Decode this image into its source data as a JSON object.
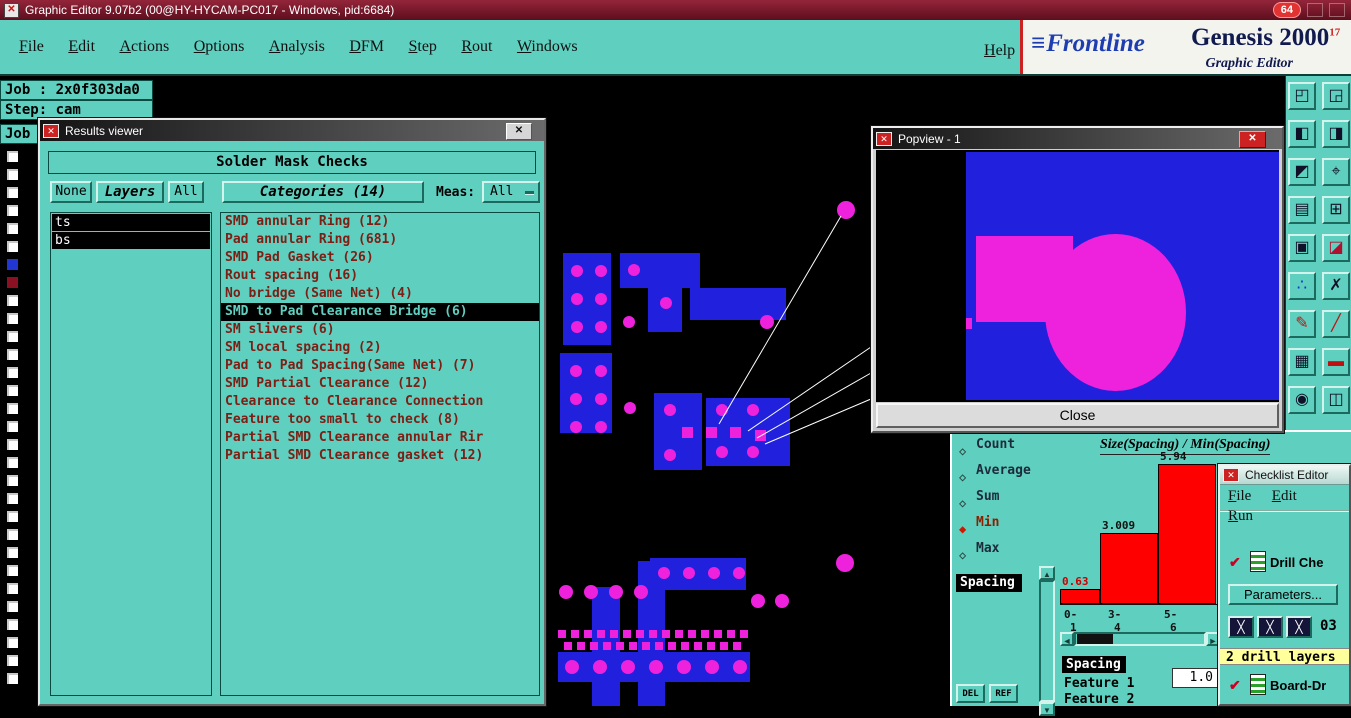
{
  "titlebar": {
    "title": "Graphic Editor 9.07b2 (00@HY-HYCAM-PC017 - Windows, pid:6684)",
    "badge": "64",
    "app_icon": "graphic-editor-app-icon"
  },
  "menubar": {
    "items": [
      "File",
      "Edit",
      "Actions",
      "Options",
      "Analysis",
      "DFM",
      "Step",
      "Rout",
      "Windows"
    ],
    "help": "Help"
  },
  "brand": {
    "logo_glyph": "≡",
    "name": "Frontline",
    "product": "Genesis 2000",
    "version": "17",
    "subtitle": "Graphic Editor"
  },
  "job_panel": {
    "job": "Job : 2x0f303da0",
    "step": "Step: cam",
    "job_short": "Job"
  },
  "results_viewer": {
    "title": "Results viewer",
    "header": "Solder Mask Checks",
    "none_btn": "None",
    "layers_btn": "Layers",
    "all_btn": "All",
    "categories_header": "Categories (14)",
    "meas_label": "Meas:",
    "meas_value": "All",
    "close_glyph": "✕",
    "layers": [
      "ts",
      "bs"
    ],
    "categories": [
      {
        "label": "SMD annular Ring (12)",
        "selected": false
      },
      {
        "label": "Pad annular Ring (681)",
        "selected": false
      },
      {
        "label": "SMD Pad Gasket (26)",
        "selected": false
      },
      {
        "label": "Rout spacing (16)",
        "selected": false
      },
      {
        "label": "No bridge (Same Net) (4)",
        "selected": false
      },
      {
        "label": "SMD to Pad Clearance Bridge (6)",
        "selected": true
      },
      {
        "label": "SM slivers (6)",
        "selected": false
      },
      {
        "label": "SM local spacing (2)",
        "selected": false
      },
      {
        "label": "Pad to Pad Spacing(Same Net) (7)",
        "selected": false
      },
      {
        "label": "SMD Partial Clearance (12)",
        "selected": false
      },
      {
        "label": "Clearance to Clearance Connection",
        "selected": false
      },
      {
        "label": "Feature too small to check (8)",
        "selected": false
      },
      {
        "label": "Partial SMD Clearance annular Rir",
        "selected": false
      },
      {
        "label": "Partial SMD Clearance gasket (12)",
        "selected": false
      }
    ]
  },
  "popview": {
    "title": "Popview - 1",
    "close": "Close",
    "close_glyph": "✕"
  },
  "measure_panel": {
    "options": [
      {
        "label": "Count",
        "selected": false
      },
      {
        "label": "Average",
        "selected": false
      },
      {
        "label": "Sum",
        "selected": false
      },
      {
        "label": "Min",
        "selected": true
      },
      {
        "label": "Max",
        "selected": false
      }
    ],
    "mode": "Spacing",
    "del_btn": "DEL",
    "ref_btn": "REF"
  },
  "histogram": {
    "title": "Size(Spacing) / Min(Spacing)",
    "bars": [
      {
        "value": "0.63",
        "range_line1": "0-",
        "range_line2": "1"
      },
      {
        "value": "3.009",
        "range_line1": "3-",
        "range_line2": "4"
      },
      {
        "value": "5.94",
        "range_line1": "5-",
        "range_line2": "6"
      }
    ]
  },
  "chart_data": {
    "type": "bar",
    "title": "Size(Spacing) / Min(Spacing)",
    "categories": [
      "0-1",
      "3-4",
      "5-6"
    ],
    "values": [
      0.63,
      3.009,
      5.94
    ],
    "ylim": [
      0,
      6
    ],
    "bar_color": "#ff0000",
    "legend_position": "none",
    "grid": false
  },
  "feature_panel": {
    "mode": "Spacing",
    "items": [
      "Feature 1",
      "Feature 2"
    ],
    "value": "1.0"
  },
  "checklist_editor": {
    "title": "Checklist Editor",
    "menus": [
      "File",
      "Edit",
      "Run"
    ],
    "action1": "Drill Che",
    "parameters_btn": "Parameters...",
    "step_no": "03",
    "info": "2 drill layers",
    "action2": "Board-Dr",
    "check_glyph": "✔",
    "dark_icon_glyph": "╳"
  },
  "layer_strip": {
    "count": 30,
    "highlights": {
      "6": "#2236d4",
      "7": "#8b1022"
    }
  },
  "toolbar": {
    "buttons": [
      {
        "name": "window-copy-icon",
        "glyph": "◰"
      },
      {
        "name": "screen-view-icon",
        "glyph": "◲"
      },
      {
        "name": "import-step-icon",
        "glyph": "◧"
      },
      {
        "name": "export-step-icon",
        "glyph": "◨"
      },
      {
        "name": "snapshot-icon",
        "glyph": "◩"
      },
      {
        "name": "pan-origin-icon",
        "glyph": "⌖"
      },
      {
        "name": "layers-table-icon",
        "glyph": "▤"
      },
      {
        "name": "grid-icon",
        "glyph": "⊞"
      },
      {
        "name": "highlight-pad-icon",
        "glyph": "▣"
      },
      {
        "name": "flag-icon",
        "glyph": "◪",
        "color": "#b01030"
      },
      {
        "name": "cluster-dots-icon",
        "glyph": "∴",
        "color": "#1133cc"
      },
      {
        "name": "delete-x-icon",
        "glyph": "✗"
      },
      {
        "name": "redline-pencil-icon",
        "glyph": "✎",
        "color": "#c01010"
      },
      {
        "name": "diagonal-measure-icon",
        "glyph": "╱",
        "color": "#c01010"
      },
      {
        "name": "select-area-icon",
        "glyph": "▦"
      },
      {
        "name": "red-bar-icon",
        "glyph": "▬",
        "color": "#c01010"
      },
      {
        "name": "center-target-icon",
        "glyph": "◉"
      },
      {
        "name": "split-view-icon",
        "glyph": "◫"
      }
    ]
  },
  "colors": {
    "teal": "#5fcfbf",
    "pcb_blue": "#2121dd",
    "pcb_magenta": "#ee22dd",
    "histogram_red": "#ff0000",
    "titlebar_red": "#7a1626",
    "info_yellow": "#ffff9c"
  },
  "scrollbar_glyphs": {
    "up": "▲",
    "down": "▼",
    "left": "◄",
    "right": "►"
  }
}
